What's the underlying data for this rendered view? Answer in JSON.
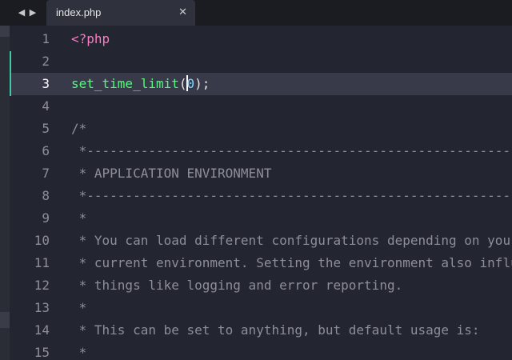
{
  "tabbar": {
    "back_icon": "◀",
    "forward_icon": "▶",
    "tab": {
      "label": "index.php",
      "close_icon": "✕"
    }
  },
  "editor": {
    "active_line": 3,
    "lines": [
      {
        "number": "1",
        "tokens": [
          {
            "t": "<?php",
            "c": "tag"
          }
        ]
      },
      {
        "number": "2",
        "tokens": []
      },
      {
        "number": "3",
        "tokens": [
          {
            "t": "set_time_limit",
            "c": "fn"
          },
          {
            "t": "(",
            "c": "punc"
          },
          {
            "t": "0",
            "c": "num",
            "cursor_before": true
          },
          {
            "t": ");",
            "c": "punc"
          }
        ]
      },
      {
        "number": "4",
        "tokens": []
      },
      {
        "number": "5",
        "tokens": [
          {
            "t": "/*",
            "c": "comment"
          }
        ]
      },
      {
        "number": "6",
        "tokens": [
          {
            "t": " *---------------------------------------------------------------",
            "c": "comment"
          }
        ]
      },
      {
        "number": "7",
        "tokens": [
          {
            "t": " * APPLICATION ENVIRONMENT",
            "c": "comment"
          }
        ]
      },
      {
        "number": "8",
        "tokens": [
          {
            "t": " *---------------------------------------------------------------",
            "c": "comment"
          }
        ]
      },
      {
        "number": "9",
        "tokens": [
          {
            "t": " *",
            "c": "comment"
          }
        ]
      },
      {
        "number": "10",
        "tokens": [
          {
            "t": " * You can load different configurations depending on your",
            "c": "comment"
          }
        ]
      },
      {
        "number": "11",
        "tokens": [
          {
            "t": " * current environment. Setting the environment also influences",
            "c": "comment"
          }
        ]
      },
      {
        "number": "12",
        "tokens": [
          {
            "t": " * things like logging and error reporting.",
            "c": "comment"
          }
        ]
      },
      {
        "number": "13",
        "tokens": [
          {
            "t": " *",
            "c": "comment"
          }
        ]
      },
      {
        "number": "14",
        "tokens": [
          {
            "t": " * This can be set to anything, but default usage is:",
            "c": "comment"
          }
        ]
      },
      {
        "number": "15",
        "tokens": [
          {
            "t": " *",
            "c": "comment"
          }
        ]
      }
    ]
  }
}
